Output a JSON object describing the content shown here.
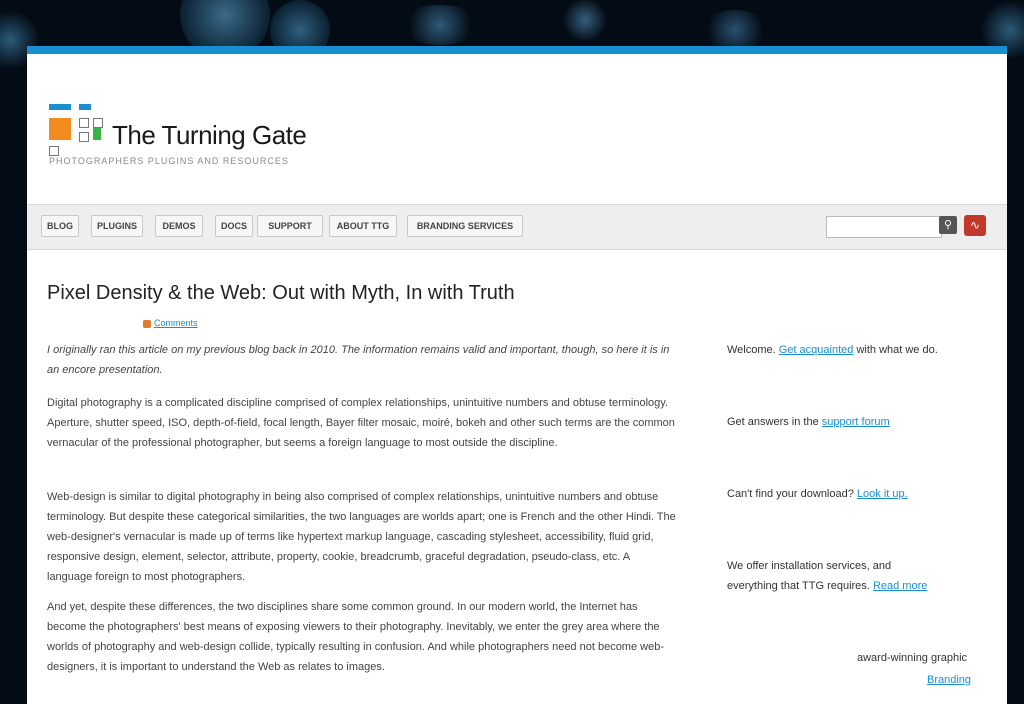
{
  "colors": {
    "accent": "#1a8fd0",
    "navBg": "#eeeeee",
    "rss": "#c0392b",
    "headingBar": "#e07c2a"
  },
  "logo": {
    "title": "The Turning Gate",
    "tagline": "PHOTOGRAPHERS PLUGINS AND RESOURCES"
  },
  "nav": {
    "items": [
      "BLOG",
      "PLUGINS",
      "DEMOS",
      "DOCS",
      "SUPPORT",
      "ABOUT TTG",
      "BRANDING SERVICES"
    ]
  },
  "search": {
    "placeholder": "",
    "search_icon": "search-icon",
    "rss_icon": "rss-icon"
  },
  "article": {
    "title": "Pixel Density & the Web: Out with Myth, In with Truth",
    "comments": "Comments",
    "intro": "I originally ran this article on my previous blog back in 2010. The information remains valid and important, though, so here it is in an encore presentation.",
    "p1": "Digital photography is a complicated discipline comprised of complex relationships, unintuitive numbers and obtuse terminology. Aperture, shutter speed, ISO, depth-of-field, focal length, Bayer filter mosaic, moiré, bokeh and other such terms are the common vernacular of the professional photographer, but seems a foreign language to most outside the discipline.",
    "p2": "Web-design is similar to digital photography in being also comprised of complex relationships, unintuitive numbers and obtuse terminology. But despite these categorical similarities, the two languages are worlds apart; one is French and the other Hindi. The web-designer's vernacular is made up of terms like hypertext markup language, cascading stylesheet, accessibility, fluid grid, responsive design, element, selector, attribute, property, cookie, breadcrumb, graceful degradation, pseudo-class, etc. A language foreign to most photographers.",
    "p3": "And yet, despite these differences, the two disciplines share some common ground. In our modern world, the Internet has become the photographers' best means of exposing viewers to their photography. Inevitably, we enter the grey area where the worlds of photography and web-design collide, typically resulting in confusion. And while photographers need not become web-designers, it is important to understand the Web as relates to images."
  },
  "sidebar": {
    "welcome_text": "Welcome.",
    "welcome_link": "Get acquainted",
    "welcome_tail": "with what we do.",
    "answers_text": "Get answers in the",
    "answers_link": "support forum",
    "download_text": "Can't find your download?",
    "download_link": "Look it up.",
    "services_text": "We offer installation services, and",
    "services_text2": "everything that TTG requires.",
    "services_link": "Read more",
    "heading2": "",
    "award_text": "award-winning graphic",
    "branding_link": "Branding"
  }
}
